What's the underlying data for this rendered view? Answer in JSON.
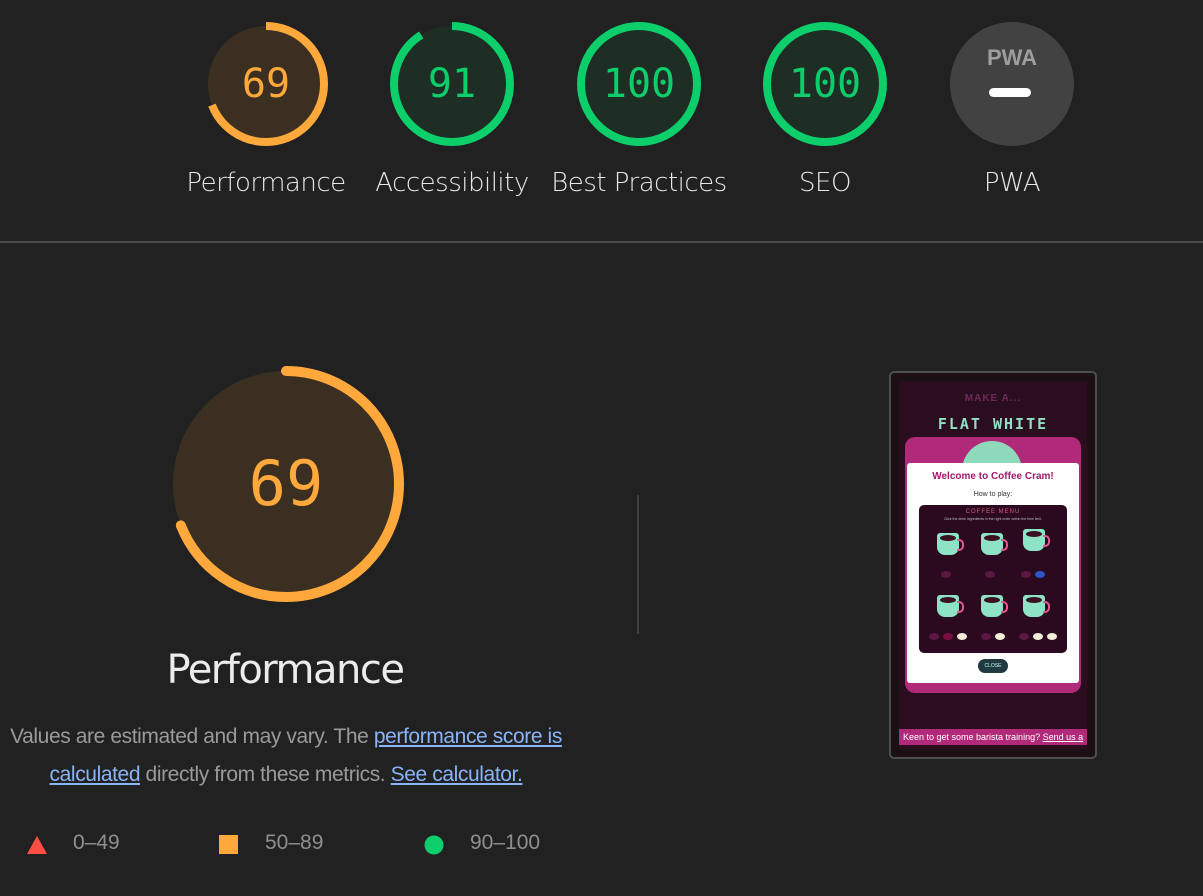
{
  "colors": {
    "fail": "#ff4e42",
    "average": "#ffa83b",
    "pass": "#0cce6b",
    "na": "#9e9e9e",
    "link": "#8ab4f8"
  },
  "categories": [
    {
      "label": "Performance",
      "score": "69",
      "value": 0.69,
      "rating": "average"
    },
    {
      "label": "Accessibility",
      "score": "91",
      "value": 0.91,
      "rating": "pass"
    },
    {
      "label": "Best Practices",
      "score": "100",
      "value": 1.0,
      "rating": "pass"
    },
    {
      "label": "SEO",
      "score": "100",
      "value": 1.0,
      "rating": "pass"
    },
    {
      "label": "PWA",
      "badge_text": "PWA",
      "rating": "na"
    }
  ],
  "performance": {
    "score": "69",
    "value": 0.69,
    "title": "Performance",
    "desc_prefix": "Values are estimated and may vary. The ",
    "desc_link1": "performance score is calculated",
    "desc_middle": " directly from these metrics. ",
    "desc_link2": "See calculator."
  },
  "legend": [
    {
      "range": "0–49",
      "shape": "triangle",
      "rating": "fail"
    },
    {
      "range": "50–89",
      "shape": "square",
      "rating": "average"
    },
    {
      "range": "90–100",
      "shape": "circle",
      "rating": "pass"
    }
  ],
  "screenshot": {
    "heading": "MAKE A...",
    "drink": "FLAT WHITE",
    "modal_title": "Welcome to Coffee Cram!",
    "modal_sub": "How to play:",
    "menu_title": "COFFEE MENU",
    "menu_sub": "Click the drink ingredients in the right order within the time limit.",
    "close": "CLOSE",
    "footer_text": "Keen to get some barista training? ",
    "footer_link": "Send us a"
  }
}
